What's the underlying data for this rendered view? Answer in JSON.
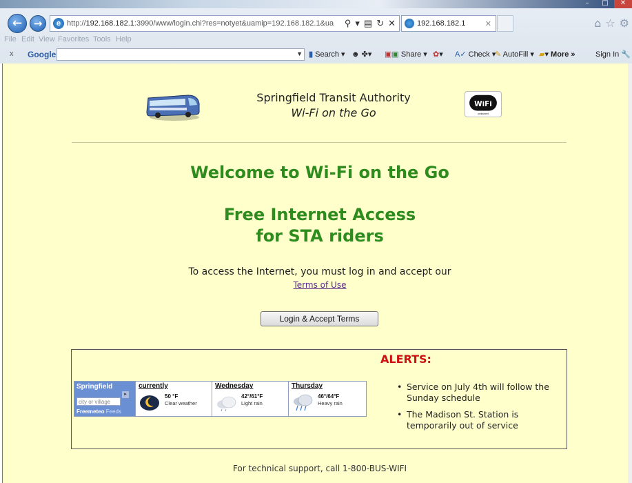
{
  "browser": {
    "url_prefix": "http://",
    "url_host": "192.168.182.1",
    "url_rest": ":3990/www/login.chi?res=notyet&uamip=192.168.182.1&ua",
    "tab_title": "192.168.182.1",
    "menu": [
      "File",
      "Edit",
      "View",
      "Favorites",
      "Tools",
      "Help"
    ],
    "google_toolbar": {
      "logo": "Google",
      "items": [
        "Search",
        "Share",
        "Check",
        "AutoFill",
        "More »",
        "Sign In"
      ]
    }
  },
  "header": {
    "org_name": "Springfield Transit Authority",
    "tagline": "Wi-Fi on the Go"
  },
  "main": {
    "welcome": "Welcome to Wi-Fi on the Go",
    "free_line1": "Free Internet Access",
    "free_line2": "for STA riders",
    "access_text": "To access the Internet, you must log in and accept our",
    "terms_link": "Terms of Use",
    "login_button": "Login & Accept Terms"
  },
  "weather": {
    "city": "Springfield",
    "city_placeholder": "city or village",
    "brand": "Freemeteo",
    "feeds": "Feeds",
    "days": [
      {
        "name": "currently",
        "temp": "50 °F",
        "cond": "Clear weather",
        "icon": "moon-icon"
      },
      {
        "name": "Wednesday",
        "temp": "42°/61°F",
        "cond": "Light rain",
        "icon": "cloud-icon"
      },
      {
        "name": "Thursday",
        "temp": "46°/64°F",
        "cond": "Heavy rain",
        "icon": "rain-cloud-icon"
      }
    ]
  },
  "alerts": {
    "title": "ALERTS:",
    "items": [
      "Service on July 4th will follow the Sunday schedule",
      "The Madison St. Station is temporarily out of service"
    ]
  },
  "footer": {
    "support": "For technical support, call 1-800-BUS-WIFI"
  },
  "colors": {
    "page_bg": "#ffffcc",
    "heading_green": "#2e8b1e",
    "alert_red": "#d01010",
    "link_purple": "#5a2a8a"
  }
}
